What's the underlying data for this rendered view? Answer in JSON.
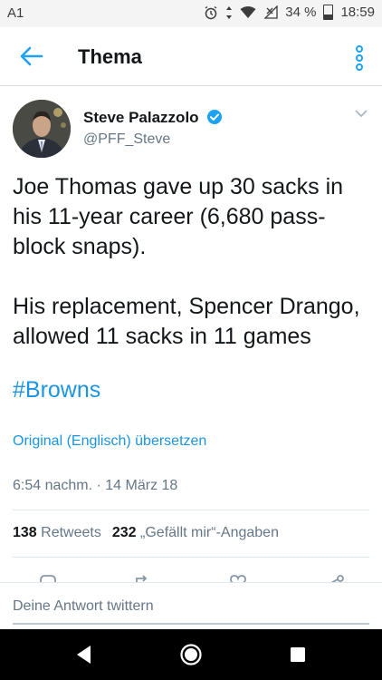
{
  "status_bar": {
    "carrier": "A1",
    "battery": "34 %",
    "time": "18:59"
  },
  "header": {
    "title": "Thema",
    "icons": {
      "back": "back-arrow-icon",
      "menu": "overflow-menu-icon"
    }
  },
  "tweet": {
    "author_name": "Steve Palazzolo",
    "handle": "@PFF_Steve",
    "verified": true,
    "text_paragraphs": [
      "Joe Thomas gave up 30 sacks in his 11-year career (6,680 pass-block snaps).",
      "His replacement, Spencer Drango, allowed 11 sacks in 11 games"
    ],
    "hashtag": "#Browns",
    "translate_link": "Original (Englisch) übersetzen",
    "timestamp": "6:54 nachm. · 14 März 18",
    "retweets_count": "138",
    "retweets_label": "Retweets",
    "likes_count": "232",
    "likes_label": "„Gefällt mir“-Angaben"
  },
  "reply": {
    "placeholder": "Deine Antwort twittern"
  },
  "colors": {
    "link": "#1b95e0",
    "secondary": "#657786",
    "verified": "#1da1f2"
  }
}
